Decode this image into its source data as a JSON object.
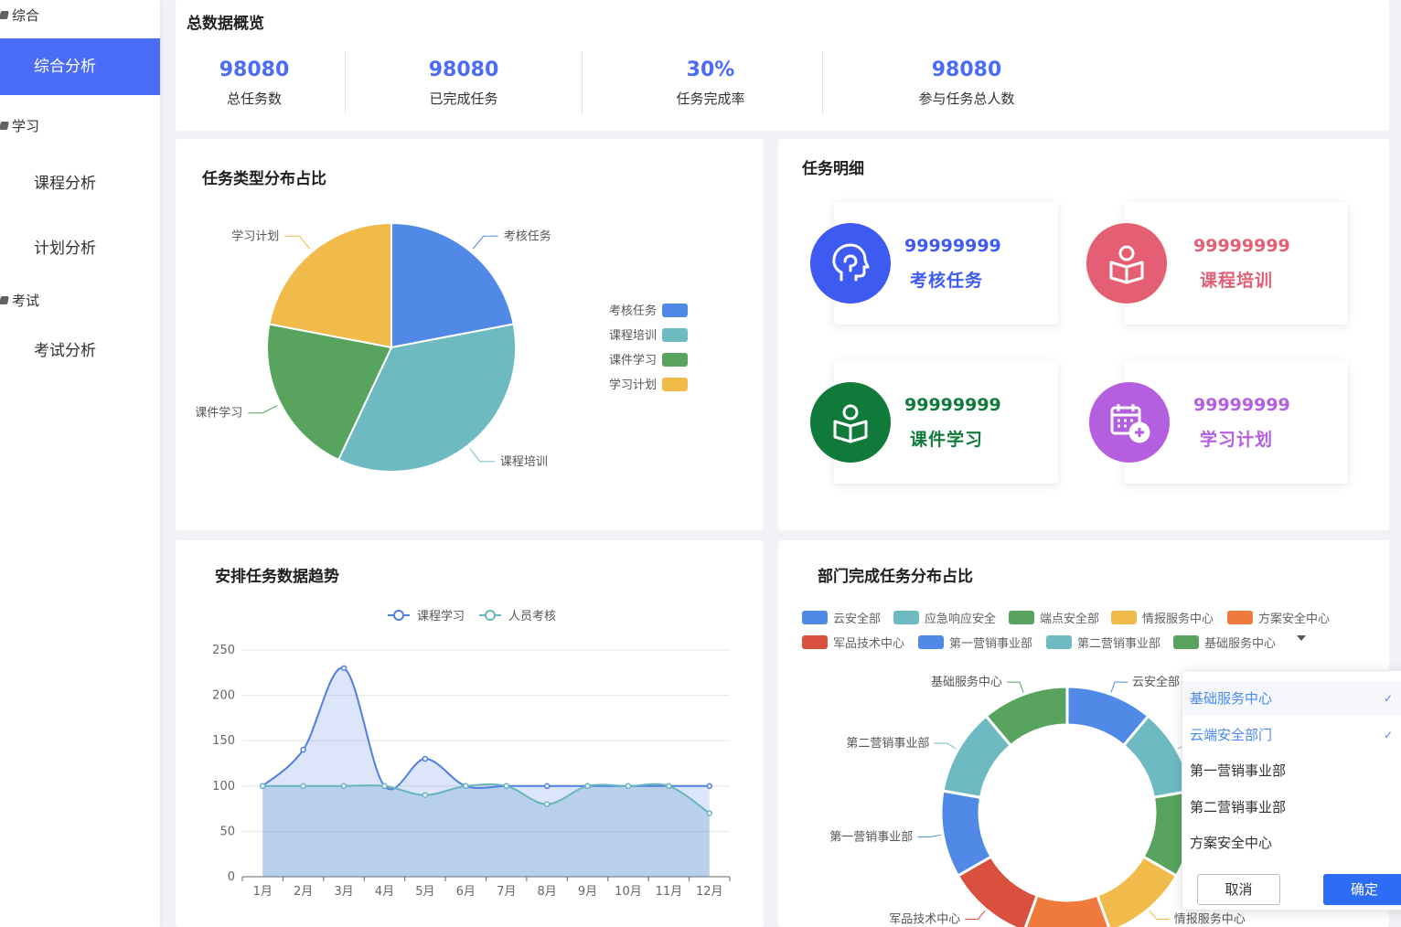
{
  "sidebar": {
    "groups": [
      {
        "label": "综合",
        "items": [
          "综合分析"
        ]
      },
      {
        "label": "学习",
        "items": [
          "课程分析",
          "计划分析"
        ]
      },
      {
        "label": "考试",
        "items": [
          "考试分析"
        ]
      }
    ],
    "active_item": "综合分析"
  },
  "overview": {
    "title": "总数据概览",
    "stats": [
      {
        "value": "98080",
        "label": "总任务数"
      },
      {
        "value": "98080",
        "label": "已完成任务"
      },
      {
        "value": "30%",
        "label": "任务完成率"
      },
      {
        "value": "98080",
        "label": "参与任务总人数"
      }
    ]
  },
  "pie_card": {
    "title": "任务类型分布占比"
  },
  "detail": {
    "title": "任务明细",
    "tiles": [
      {
        "value": "99999999",
        "label": "考核任务",
        "color": "#3d5af1",
        "icon": "brain-head-icon"
      },
      {
        "value": "99999999",
        "label": "课程培训",
        "color": "#e45f73",
        "icon": "reader-icon"
      },
      {
        "value": "99999999",
        "label": "课件学习",
        "color": "#0f7a3a",
        "icon": "reader-icon"
      },
      {
        "value": "99999999",
        "label": "学习计划",
        "color": "#b45ee0",
        "icon": "calendar-plus-icon"
      }
    ]
  },
  "trend_card": {
    "title": "安排任务数据趋势"
  },
  "dept_card": {
    "title": "部门完成任务分布占比"
  },
  "dropdown": {
    "options": [
      "基础服务中心",
      "云端安全部门",
      "第一营销事业部",
      "第二营销事业部",
      "方案安全中心"
    ],
    "selected": [
      "基础服务中心",
      "云端安全部门"
    ],
    "cancel_label": "取消",
    "ok_label": "确定"
  },
  "chart_data": [
    {
      "type": "pie",
      "title": "任务类型分布占比",
      "legend_position": "right",
      "slices": [
        {
          "name": "考核任务",
          "value": 22,
          "color": "#5089e6"
        },
        {
          "name": "课程培训",
          "value": 35,
          "color": "#6dbac1"
        },
        {
          "name": "课件学习",
          "value": 21,
          "color": "#58a35e"
        },
        {
          "name": "学习计划",
          "value": 22,
          "color": "#f0bb4b"
        }
      ]
    },
    {
      "type": "line",
      "title": "安排任务数据趋势",
      "legend_position": "top",
      "categories": [
        "1月",
        "2月",
        "3月",
        "4月",
        "5月",
        "6月",
        "7月",
        "8月",
        "9月",
        "10月",
        "11月",
        "12月"
      ],
      "ylim": [
        0,
        250
      ],
      "yticks": [
        0,
        50,
        100,
        150,
        200,
        250
      ],
      "grid": true,
      "series": [
        {
          "name": "课程学习",
          "values": [
            100,
            140,
            230,
            100,
            130,
            100,
            100,
            100,
            100,
            100,
            100,
            100
          ],
          "color": "#4f7fe0"
        },
        {
          "name": "人员考核",
          "values": [
            100,
            100,
            100,
            100,
            90,
            100,
            100,
            80,
            100,
            100,
            100,
            70
          ],
          "color": "#69b5bf"
        }
      ]
    },
    {
      "type": "pie",
      "subtype": "donut",
      "title": "部门完成任务分布占比",
      "legend_position": "top",
      "legend": [
        {
          "name": "云安全部",
          "color": "#5089e6"
        },
        {
          "name": "应急响应安全",
          "color": "#6dbac1"
        },
        {
          "name": "端点安全部",
          "color": "#58a35e"
        },
        {
          "name": "情报服务中心",
          "color": "#f0bb4b"
        },
        {
          "name": "方案安全中心",
          "color": "#ef7a3b"
        },
        {
          "name": "军品技术中心",
          "color": "#d9503f"
        },
        {
          "name": "第一营销事业部",
          "color": "#5089e6"
        },
        {
          "name": "第二营销事业部",
          "color": "#6dbac1"
        },
        {
          "name": "基础服务中心",
          "color": "#58a35e"
        }
      ],
      "slices": [
        {
          "name": "云安全部",
          "value": 1,
          "color": "#5089e6"
        },
        {
          "name": "应急响应安全",
          "value": 1,
          "color": "#6dbac1"
        },
        {
          "name": "端点安全部",
          "value": 1,
          "color": "#58a35e"
        },
        {
          "name": "情报服务中心",
          "value": 1,
          "color": "#f0bb4b"
        },
        {
          "name": "方案安全中心",
          "value": 1,
          "color": "#ef7a3b"
        },
        {
          "name": "军品技术中心",
          "value": 1,
          "color": "#d9503f"
        },
        {
          "name": "第一营销事业部",
          "value": 1,
          "color": "#5089e6"
        },
        {
          "name": "第二营销事业部",
          "value": 1,
          "color": "#6dbac1"
        },
        {
          "name": "基础服务中心",
          "value": 1,
          "color": "#58a35e"
        }
      ]
    }
  ]
}
